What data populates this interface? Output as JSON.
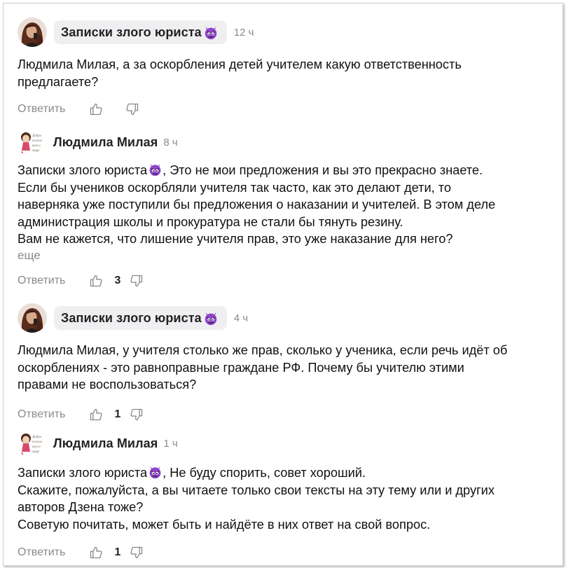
{
  "actions": {
    "reply_label": "Ответить",
    "more_label": "еще"
  },
  "comments": [
    {
      "author": "Записки злого юриста",
      "time": "12 ч",
      "avatar": "woman-photo-avatar",
      "author_badge": "devil-emoji",
      "lines": [
        "Людмила Милая, а за оскорбления детей учителем какую ответственность",
        "предлагаете?"
      ],
      "likes": ""
    },
    {
      "author": "Людмила Милая",
      "time": "8 ч",
      "avatar": "cartoon-girl-avatar",
      "mention": "Записки злого юриста",
      "first_line_rest": ", Это не мои предложения и вы это прекрасно знаете.",
      "lines": [
        "Если бы учеников оскорбляли учителя так часто, как это делают дети, то",
        "наверняка уже поступили бы предложения о наказании и учителей. В этом деле",
        "администрация школы и прокуратура не стали бы тянуть резину.",
        "Вам не кажется, что лишение учителя прав, это уже наказание для него?"
      ],
      "likes": "3"
    },
    {
      "author": "Записки злого юриста",
      "time": "4 ч",
      "avatar": "woman-photo-avatar",
      "author_badge": "devil-emoji",
      "lines": [
        "Людмила Милая, у учителя столько же прав, сколько у ученика, если речь идёт об",
        "оскорблениях - это равноправные граждане РФ. Почему бы учителю этими",
        "правами не воспользоваться?"
      ],
      "likes": "1"
    },
    {
      "author": "Людмила Милая",
      "time": "1 ч",
      "avatar": "cartoon-girl-avatar",
      "mention": "Записки злого юриста",
      "first_line_rest": ", Не буду спорить, совет хороший.",
      "lines": [
        "Скажите, пожалуйста, а вы читаете только свои тексты на эту тему или и других",
        "авторов Дзена тоже?",
        "Советую почитать, может быть и найдёте в них ответ на свой вопрос."
      ],
      "likes": "1"
    }
  ]
}
